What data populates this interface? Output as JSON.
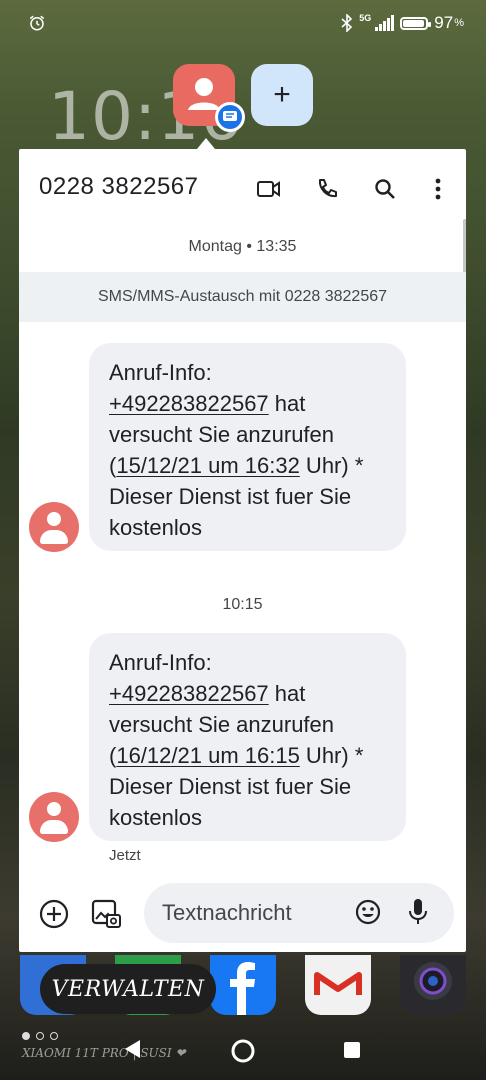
{
  "status_bar": {
    "network": "5G",
    "battery_percent": "97",
    "battery_level": 0.97
  },
  "wallpaper_clock": "10:16",
  "bubble": {
    "add_label": "+"
  },
  "conversation": {
    "title": "0228 3822567",
    "date_separator": "Montag • 13:35",
    "banner": "SMS/MMS-Austausch mit 0228 3822567",
    "time_separator": "10:15",
    "messages": [
      {
        "line1": "Anruf-Info:",
        "number": "+492283822567",
        "line2_rest": " hat",
        "line3": "versucht Sie anzurufen",
        "paren_open": "(",
        "datetime": "15/12/21 um 16:32",
        "line4_rest": " Uhr) *",
        "line5": "Dieser Dienst ist fuer Sie",
        "line6": "kostenlos"
      },
      {
        "line1": "Anruf-Info:",
        "number": "+492283822567",
        "line2_rest": " hat",
        "line3": "versucht Sie anzurufen",
        "paren_open": "(",
        "datetime": "16/12/21 um 16:15",
        "line4_rest": " Uhr) *",
        "line5": "Dieser Dienst ist fuer Sie",
        "line6": "kostenlos"
      }
    ],
    "last_message_status": "Jetzt"
  },
  "composer": {
    "placeholder": "Textnachricht"
  },
  "launcher": {
    "manage_label": "VERWALTEN",
    "watermark": "XIAOMI 11T PRO | SUSI ❤"
  },
  "icons": [
    "alarm-icon",
    "bluetooth-icon",
    "signal-icon",
    "battery-icon",
    "video-call-icon",
    "phone-icon",
    "search-icon",
    "more-icon",
    "add-icon",
    "gallery-icon",
    "emoji-icon",
    "mic-icon",
    "back-icon",
    "home-icon",
    "recents-icon"
  ]
}
